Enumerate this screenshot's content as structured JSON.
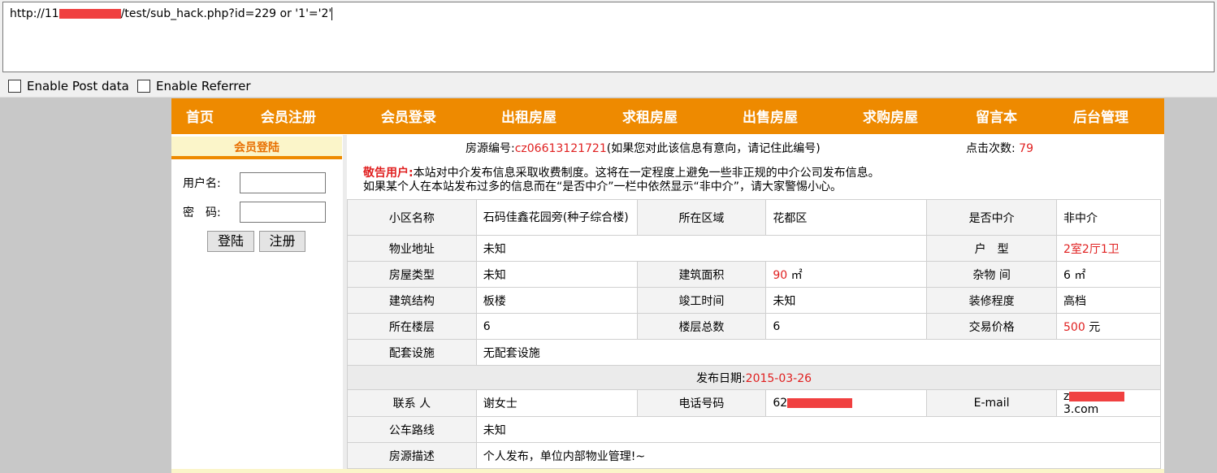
{
  "url_bar": {
    "prefix": "http://11",
    "suffix": "/test/sub_hack.php?id=229 or '1'='2'"
  },
  "options": {
    "post_label": "Enable Post data",
    "referrer_label": "Enable Referrer"
  },
  "nav": [
    "首页",
    "会员注册",
    "会员登录",
    "出租房屋",
    "求租房屋",
    "出售房屋",
    "求购房屋",
    "留言本",
    "后台管理"
  ],
  "sidebar": {
    "title": "会员登陆",
    "username_label": "用户名:",
    "password_label": "密　码:",
    "login_button": "登陆",
    "register_button": "注册"
  },
  "listing": {
    "source_label": "房源编号:",
    "source_id": "cz06613121721",
    "source_note": "(如果您对此该信息有意向，请记住此编号)",
    "clicks_label": "点击次数:",
    "clicks_value": "79",
    "notice_warn": "敬告用户:",
    "notice_line1": "本站对中介发布信息采取收费制度。这将在一定程度上避免一些非正规的中介公司发布信息。",
    "notice_line2": "如果某个人在本站发布过多的信息而在“是否中介”一栏中依然显示“非中介”，请大家警惕小心。"
  },
  "table": {
    "community_label": "小区名称",
    "community_value": "石码佳鑫花园旁(种子综合楼)",
    "district_label": "所在区域",
    "district_value": "花都区",
    "agent_label": "是否中介",
    "agent_value": "非中介",
    "address_label": "物业地址",
    "address_value": "未知",
    "layout_label": "户　型",
    "layout_value": "2室2厅1卫",
    "type_label": "房屋类型",
    "type_value": "未知",
    "area_label": "建筑面积",
    "area_value": "90",
    "area_unit": "㎡",
    "storage_label": "杂物 间",
    "storage_value": "6 ㎡",
    "structure_label": "建筑结构",
    "structure_value": "板楼",
    "completed_label": "竣工时间",
    "completed_value": "未知",
    "decor_label": "装修程度",
    "decor_value": "高档",
    "floor_label": "所在楼层",
    "floor_value": "6",
    "total_floors_label": "楼层总数",
    "total_floors_value": "6",
    "price_label": "交易价格",
    "price_value": "500",
    "price_unit": "元",
    "facilities_label": "配套设施",
    "facilities_value": "无配套设施",
    "date_label": "发布日期:",
    "date_value": "2015-03-26",
    "contact_label": "联系 人",
    "contact_value": "谢女士",
    "phone_label": "电话号码",
    "phone_prefix": "62",
    "email_label": "E-mail",
    "email_prefix": "z",
    "email_suffix": "3.com",
    "bus_label": "公车路线",
    "bus_value": "未知",
    "desc_label": "房源描述",
    "desc_value": "个人发布，单位内部物业管理!~"
  }
}
